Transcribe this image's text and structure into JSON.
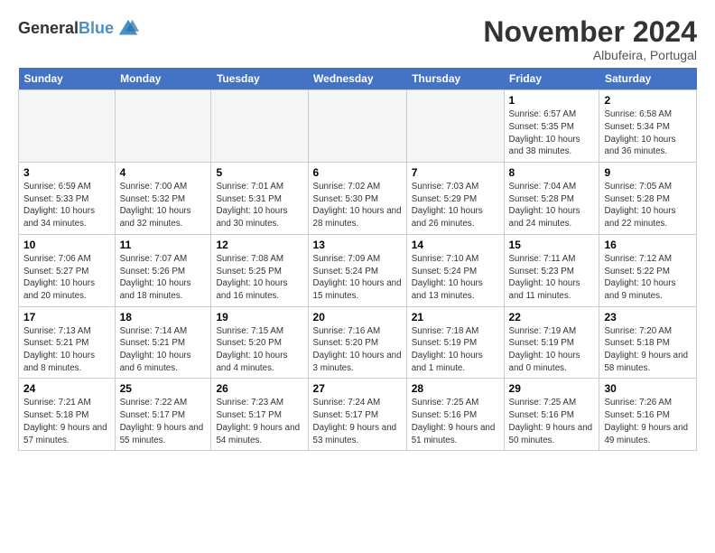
{
  "header": {
    "logo_general": "General",
    "logo_blue": "Blue",
    "month_title": "November 2024",
    "location": "Albufeira, Portugal"
  },
  "days_of_week": [
    "Sunday",
    "Monday",
    "Tuesday",
    "Wednesday",
    "Thursday",
    "Friday",
    "Saturday"
  ],
  "weeks": [
    [
      {
        "day": "",
        "empty": true
      },
      {
        "day": "",
        "empty": true
      },
      {
        "day": "",
        "empty": true
      },
      {
        "day": "",
        "empty": true
      },
      {
        "day": "",
        "empty": true
      },
      {
        "day": "1",
        "sunrise": "Sunrise: 6:57 AM",
        "sunset": "Sunset: 5:35 PM",
        "daylight": "Daylight: 10 hours and 38 minutes."
      },
      {
        "day": "2",
        "sunrise": "Sunrise: 6:58 AM",
        "sunset": "Sunset: 5:34 PM",
        "daylight": "Daylight: 10 hours and 36 minutes."
      }
    ],
    [
      {
        "day": "3",
        "sunrise": "Sunrise: 6:59 AM",
        "sunset": "Sunset: 5:33 PM",
        "daylight": "Daylight: 10 hours and 34 minutes."
      },
      {
        "day": "4",
        "sunrise": "Sunrise: 7:00 AM",
        "sunset": "Sunset: 5:32 PM",
        "daylight": "Daylight: 10 hours and 32 minutes."
      },
      {
        "day": "5",
        "sunrise": "Sunrise: 7:01 AM",
        "sunset": "Sunset: 5:31 PM",
        "daylight": "Daylight: 10 hours and 30 minutes."
      },
      {
        "day": "6",
        "sunrise": "Sunrise: 7:02 AM",
        "sunset": "Sunset: 5:30 PM",
        "daylight": "Daylight: 10 hours and 28 minutes."
      },
      {
        "day": "7",
        "sunrise": "Sunrise: 7:03 AM",
        "sunset": "Sunset: 5:29 PM",
        "daylight": "Daylight: 10 hours and 26 minutes."
      },
      {
        "day": "8",
        "sunrise": "Sunrise: 7:04 AM",
        "sunset": "Sunset: 5:28 PM",
        "daylight": "Daylight: 10 hours and 24 minutes."
      },
      {
        "day": "9",
        "sunrise": "Sunrise: 7:05 AM",
        "sunset": "Sunset: 5:28 PM",
        "daylight": "Daylight: 10 hours and 22 minutes."
      }
    ],
    [
      {
        "day": "10",
        "sunrise": "Sunrise: 7:06 AM",
        "sunset": "Sunset: 5:27 PM",
        "daylight": "Daylight: 10 hours and 20 minutes."
      },
      {
        "day": "11",
        "sunrise": "Sunrise: 7:07 AM",
        "sunset": "Sunset: 5:26 PM",
        "daylight": "Daylight: 10 hours and 18 minutes."
      },
      {
        "day": "12",
        "sunrise": "Sunrise: 7:08 AM",
        "sunset": "Sunset: 5:25 PM",
        "daylight": "Daylight: 10 hours and 16 minutes."
      },
      {
        "day": "13",
        "sunrise": "Sunrise: 7:09 AM",
        "sunset": "Sunset: 5:24 PM",
        "daylight": "Daylight: 10 hours and 15 minutes."
      },
      {
        "day": "14",
        "sunrise": "Sunrise: 7:10 AM",
        "sunset": "Sunset: 5:24 PM",
        "daylight": "Daylight: 10 hours and 13 minutes."
      },
      {
        "day": "15",
        "sunrise": "Sunrise: 7:11 AM",
        "sunset": "Sunset: 5:23 PM",
        "daylight": "Daylight: 10 hours and 11 minutes."
      },
      {
        "day": "16",
        "sunrise": "Sunrise: 7:12 AM",
        "sunset": "Sunset: 5:22 PM",
        "daylight": "Daylight: 10 hours and 9 minutes."
      }
    ],
    [
      {
        "day": "17",
        "sunrise": "Sunrise: 7:13 AM",
        "sunset": "Sunset: 5:21 PM",
        "daylight": "Daylight: 10 hours and 8 minutes."
      },
      {
        "day": "18",
        "sunrise": "Sunrise: 7:14 AM",
        "sunset": "Sunset: 5:21 PM",
        "daylight": "Daylight: 10 hours and 6 minutes."
      },
      {
        "day": "19",
        "sunrise": "Sunrise: 7:15 AM",
        "sunset": "Sunset: 5:20 PM",
        "daylight": "Daylight: 10 hours and 4 minutes."
      },
      {
        "day": "20",
        "sunrise": "Sunrise: 7:16 AM",
        "sunset": "Sunset: 5:20 PM",
        "daylight": "Daylight: 10 hours and 3 minutes."
      },
      {
        "day": "21",
        "sunrise": "Sunrise: 7:18 AM",
        "sunset": "Sunset: 5:19 PM",
        "daylight": "Daylight: 10 hours and 1 minute."
      },
      {
        "day": "22",
        "sunrise": "Sunrise: 7:19 AM",
        "sunset": "Sunset: 5:19 PM",
        "daylight": "Daylight: 10 hours and 0 minutes."
      },
      {
        "day": "23",
        "sunrise": "Sunrise: 7:20 AM",
        "sunset": "Sunset: 5:18 PM",
        "daylight": "Daylight: 9 hours and 58 minutes."
      }
    ],
    [
      {
        "day": "24",
        "sunrise": "Sunrise: 7:21 AM",
        "sunset": "Sunset: 5:18 PM",
        "daylight": "Daylight: 9 hours and 57 minutes."
      },
      {
        "day": "25",
        "sunrise": "Sunrise: 7:22 AM",
        "sunset": "Sunset: 5:17 PM",
        "daylight": "Daylight: 9 hours and 55 minutes."
      },
      {
        "day": "26",
        "sunrise": "Sunrise: 7:23 AM",
        "sunset": "Sunset: 5:17 PM",
        "daylight": "Daylight: 9 hours and 54 minutes."
      },
      {
        "day": "27",
        "sunrise": "Sunrise: 7:24 AM",
        "sunset": "Sunset: 5:17 PM",
        "daylight": "Daylight: 9 hours and 53 minutes."
      },
      {
        "day": "28",
        "sunrise": "Sunrise: 7:25 AM",
        "sunset": "Sunset: 5:16 PM",
        "daylight": "Daylight: 9 hours and 51 minutes."
      },
      {
        "day": "29",
        "sunrise": "Sunrise: 7:25 AM",
        "sunset": "Sunset: 5:16 PM",
        "daylight": "Daylight: 9 hours and 50 minutes."
      },
      {
        "day": "30",
        "sunrise": "Sunrise: 7:26 AM",
        "sunset": "Sunset: 5:16 PM",
        "daylight": "Daylight: 9 hours and 49 minutes."
      }
    ]
  ]
}
